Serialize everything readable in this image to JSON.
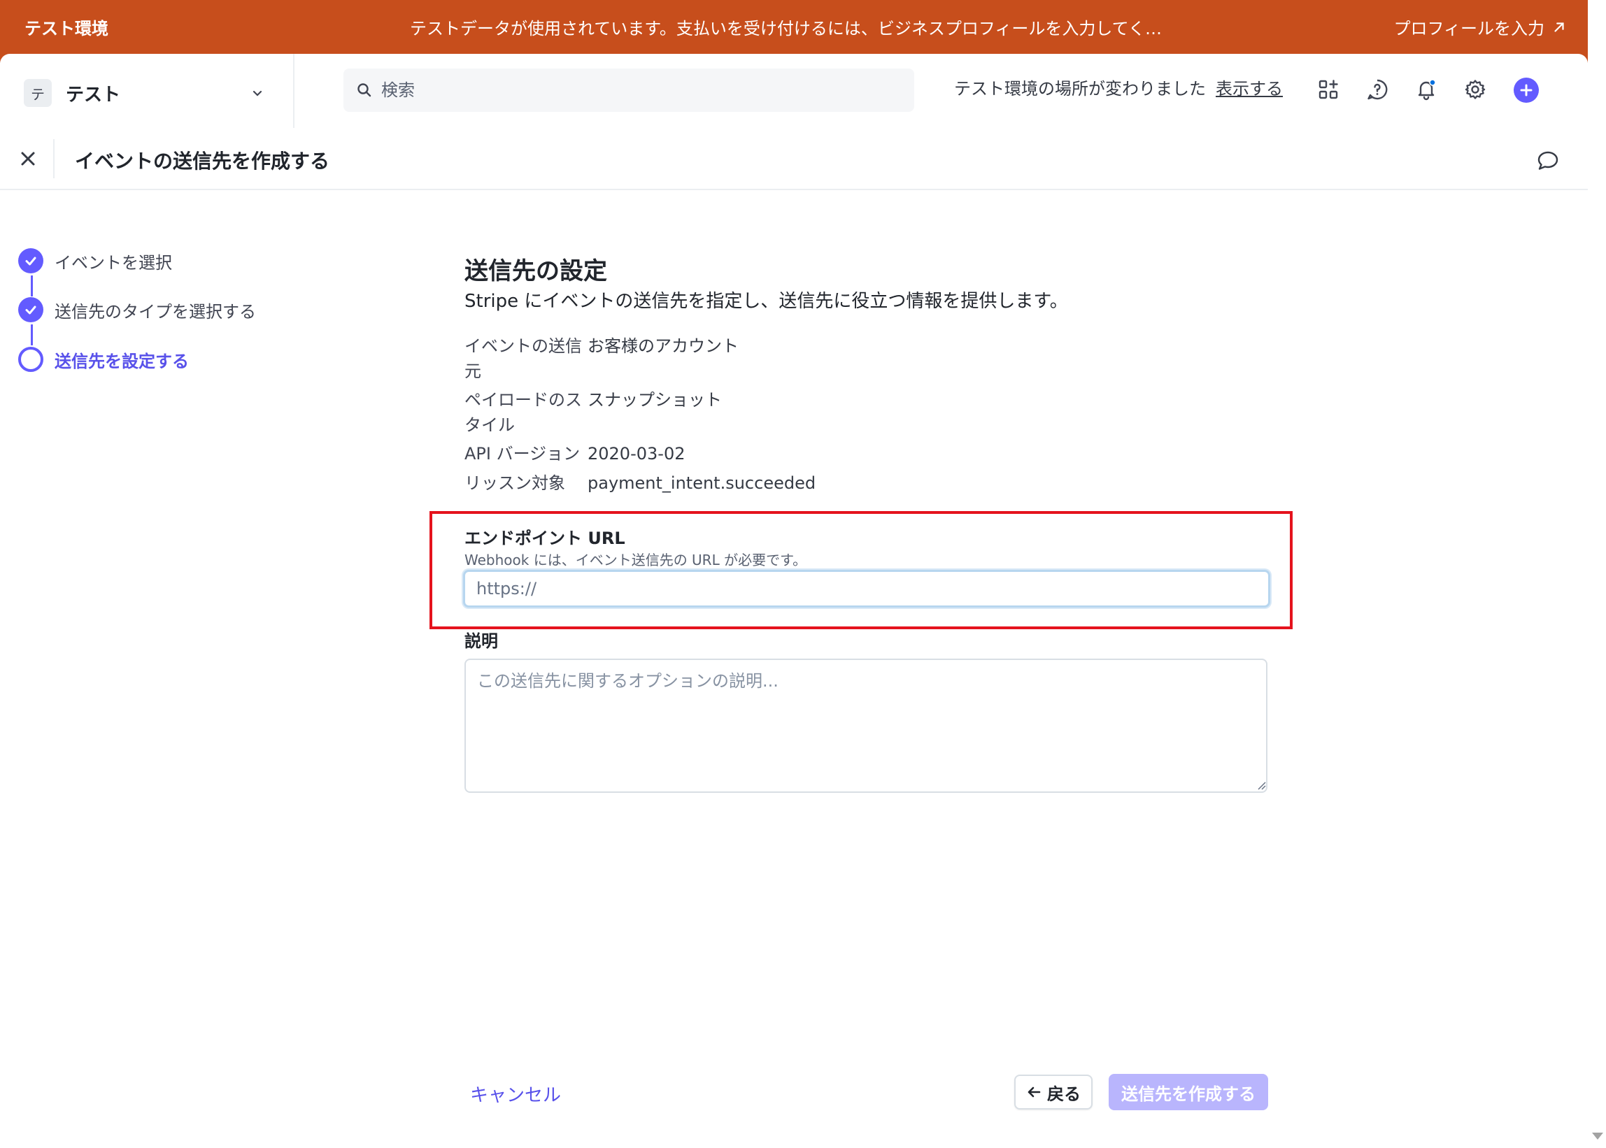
{
  "banner": {
    "env_label": "テスト環境",
    "message": "テストデータが使用されています。支払いを受け付けるには、ビジネスプロフィールを入力してく…",
    "profile_link": "プロフィールを入力"
  },
  "header": {
    "account_initial": "テ",
    "account_name": "テスト",
    "search_placeholder": "検索",
    "notice_text": "テスト環境の場所が変わりました",
    "notice_link": "表示する",
    "icons": [
      "apps-icon",
      "help-icon",
      "bell-icon",
      "gear-icon",
      "plus-icon"
    ],
    "accent_color": "#635bff"
  },
  "dialog": {
    "title": "イベントの送信先を作成する"
  },
  "steps": [
    {
      "label": "イベントを選択",
      "state": "done"
    },
    {
      "label": "送信先のタイプを選択する",
      "state": "done"
    },
    {
      "label": "送信先を設定する",
      "state": "current"
    }
  ],
  "form": {
    "section_title": "送信先の設定",
    "section_subtitle": "Stripe にイベントの送信先を指定し、送信先に役立つ情報を提供します。",
    "meta": [
      {
        "label_line1": "イベントの送信",
        "label_line2": "元",
        "value": "お客様のアカウント"
      },
      {
        "label_line1": "ペイロードのス",
        "label_line2": "タイル",
        "value": "スナップショット"
      },
      {
        "label_line1": "API バージョン",
        "label_line2": "",
        "value": "2020-03-02"
      },
      {
        "label_line1": "リッスン対象",
        "label_line2": "",
        "value": "payment_intent.succeeded"
      }
    ],
    "endpoint": {
      "label": "エンドポイント URL",
      "help": "Webhook には、イベント送信先の URL が必要です。",
      "placeholder": "https://",
      "value": ""
    },
    "description": {
      "label": "説明",
      "placeholder": "この送信先に関するオプションの説明...",
      "value": ""
    }
  },
  "footer": {
    "cancel": "キャンセル",
    "back": "戻る",
    "create": "送信先を作成する"
  },
  "highlight_color": "#e5131d",
  "banner_color": "#c74e1c"
}
